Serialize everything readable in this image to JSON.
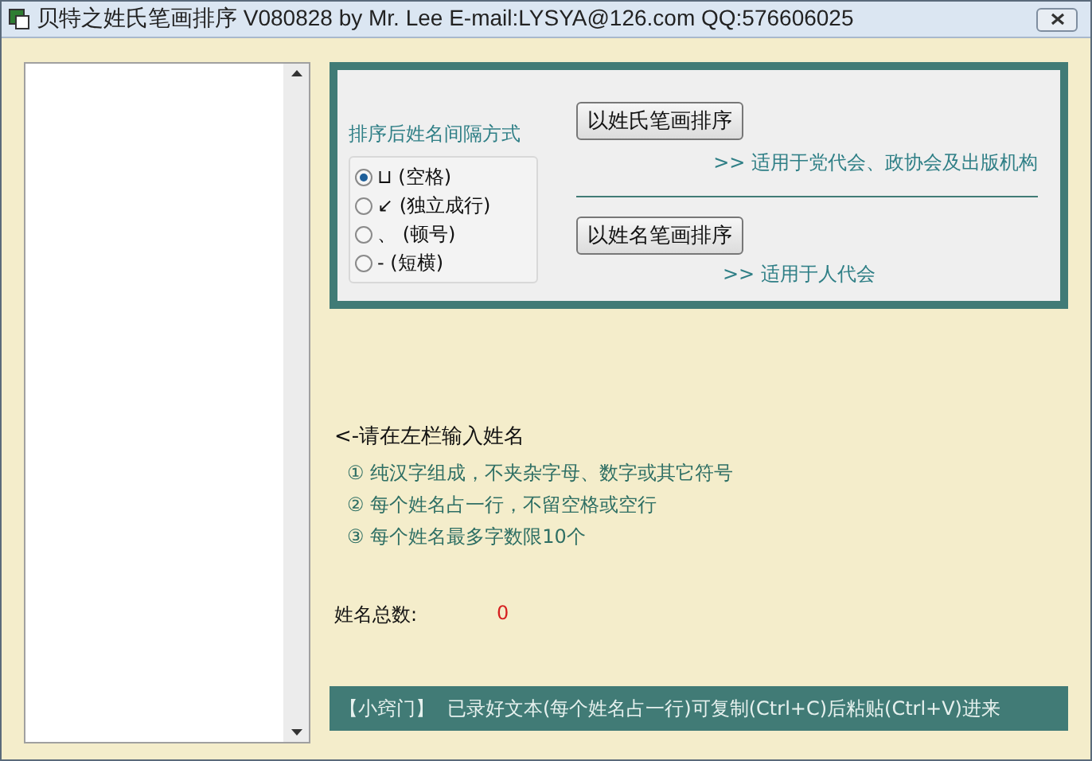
{
  "window": {
    "title": "贝特之姓氏笔画排序  V080828  by Mr. Lee  E-mail:LYSYA@126.com  QQ:576606025"
  },
  "separator": {
    "label": "排序后姓名间隔方式",
    "options": [
      {
        "label": "⊔ (空格)",
        "selected": true
      },
      {
        "label": "↙ (独立成行)",
        "selected": false
      },
      {
        "label": "、 (顿号)",
        "selected": false
      },
      {
        "label": "- (短横)",
        "selected": false
      }
    ]
  },
  "sort_buttons": [
    {
      "label": "以姓氏笔画排序",
      "note": ">> 适用于党代会、政协会及出版机构"
    },
    {
      "label": "以姓名笔画排序",
      "note": ">> 适用于人代会"
    }
  ],
  "hint": {
    "title": "<-请在左栏输入姓名",
    "rules": [
      "① 纯汉字组成，不夹杂字母、数字或其它符号",
      "② 每个姓名占一行，不留空格或空行",
      "③ 每个姓名最多字数限10个"
    ]
  },
  "total": {
    "label": "姓名总数:",
    "value": "0"
  },
  "tip": {
    "tag": "【小窍门】",
    "text": "已录好文本(每个姓名占一行)可复制(Ctrl+C)后粘贴(Ctrl+V)进来"
  }
}
